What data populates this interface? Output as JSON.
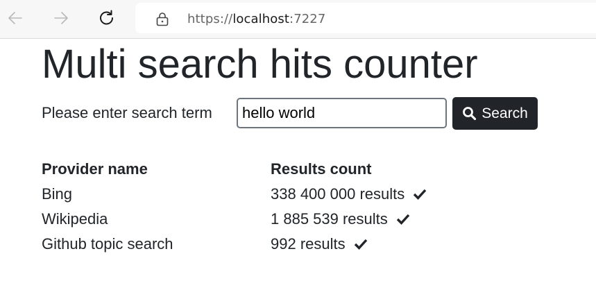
{
  "browser": {
    "url_scheme": "https://",
    "url_host": "localhost",
    "url_port": ":7227",
    "icons": [
      "back-arrow-icon",
      "forward-arrow-icon",
      "reload-icon",
      "lock-icon"
    ]
  },
  "page": {
    "title": "Multi search hits counter",
    "search_label": "Please enter search term",
    "search_value": "hello world",
    "search_button_label": "Search",
    "search_button_icon": "search-icon"
  },
  "table": {
    "headers": [
      "Provider name",
      "Results count"
    ],
    "rows": [
      {
        "provider": "Bing",
        "count": "338 400 000 results",
        "status_icon": "checkmark-icon"
      },
      {
        "provider": "Wikipedia",
        "count": "1 885 539 results",
        "status_icon": "checkmark-icon"
      },
      {
        "provider": "Github topic search",
        "count": "992 results",
        "status_icon": "checkmark-icon"
      }
    ]
  },
  "colors": {
    "text": "#212529",
    "button_bg": "#212529",
    "browser_bar": "#f7f7f7"
  }
}
